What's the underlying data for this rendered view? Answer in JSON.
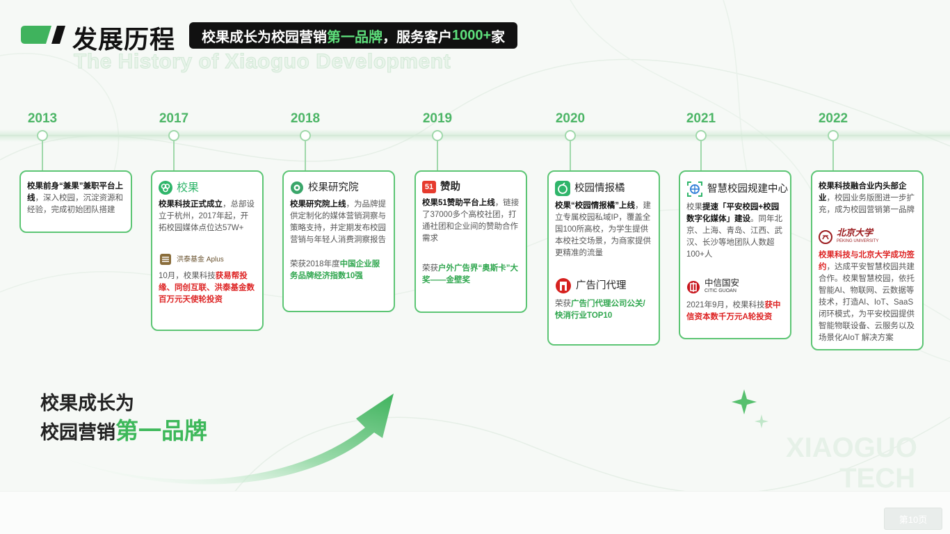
{
  "header": {
    "title": "发展历程",
    "slogan_1": "校果成长为校园营销",
    "slogan_hl_1": "第一品牌",
    "slogan_2": "，服务客户",
    "slogan_hl_2": "1000+",
    "slogan_3": "家",
    "en_title": "The History of Xiaoguo Development"
  },
  "timeline": [
    {
      "year": "2013"
    },
    {
      "year": "2017"
    },
    {
      "year": "2018"
    },
    {
      "year": "2019"
    },
    {
      "year": "2020"
    },
    {
      "year": "2021"
    },
    {
      "year": "2022"
    }
  ],
  "cards": {
    "c2013": {
      "b1": "校果前身“兼果”兼职平台上线",
      "t1": "，深入校园，沉淀资源和经验，完成初始团队搭建"
    },
    "c2017": {
      "brand": "校果",
      "b1": "校果科技正式成立",
      "t1": "，总部设立于杭州，2017年起，开拓校园媒体点位达57W+",
      "brand2": "洪泰基金 Aplus",
      "t2": "10月，校果科技",
      "r2": "获易帮投缘、同创互联、洪泰基金数百万元天使轮投资"
    },
    "c2018": {
      "brand": "校果研究院",
      "b1": "校果研究院上线",
      "t1": "，为品牌提供定制化的媒体营销洞察与策略支持，并定期发布校园营销与年轻人消费洞察报告",
      "t2": "荣获2018年度",
      "g2": "中国企业服务品牌经济指数10强"
    },
    "c2019": {
      "brand": "赞助",
      "brand_logo": "51",
      "b1": "校果51赞助平台上线",
      "t1": "，链接了37000多个高校社团，打通社团和企业间的赞助合作需求",
      "t2": "荣获",
      "r2": "户外广告界“奥斯卡”大奖——金壁奖"
    },
    "c2020": {
      "brand": "校园情报橘",
      "b1": "校果“校园情报橘”上线",
      "t1": "，建立专属校园私域IP，覆盖全国100所高校，为学生提供本校社交场景，为商家提供更精准的流量",
      "brand2": "广告门代理",
      "t2": "荣获",
      "g2": "广告门代理公司公关/快消行业TOP10"
    },
    "c2021": {
      "brand": "智慧校园规建中心",
      "t0": "校果",
      "b1": "提速「平安校园+校园数字化媒体」建设",
      "t1": "。同年北京、上海、青岛、江西、武汉、长沙等地团队人数超100+人",
      "brand2": "中信国安",
      "brand2_sub": "CITIC GUOAN",
      "t2": "2021年9月，校果科技",
      "r2": "获中信资本数千万元A轮投资"
    },
    "c2022": {
      "b1": "校果科技融合业内头部企业",
      "t1": "，校园业务版图进一步扩充，成为校园营销第一品牌",
      "brand2": "北京大学",
      "brand2_sub": "PEKING UNIVERSITY",
      "r2": "校果科技与北京大学成功签约",
      "t2": "，达成平安智慧校园共建合作。校果智慧校园，依托智能AI、物联网、云数据等技术，打造AI、IoT、SaaS闭环模式，为平安校园提供智能物联设备、云服务以及场景化AIoT 解决方案"
    }
  },
  "bottom": {
    "line1": "校果成长为",
    "line2": "校园营销",
    "hl": "第一品牌"
  },
  "watermark": {
    "line1": "XIAOGUO",
    "line2": "TECH"
  },
  "page_label": "第10页",
  "colors": {
    "accent": "#4cb566",
    "card_border": "#5cc574",
    "highlight_red": "#dd2222",
    "dark": "#111111"
  }
}
